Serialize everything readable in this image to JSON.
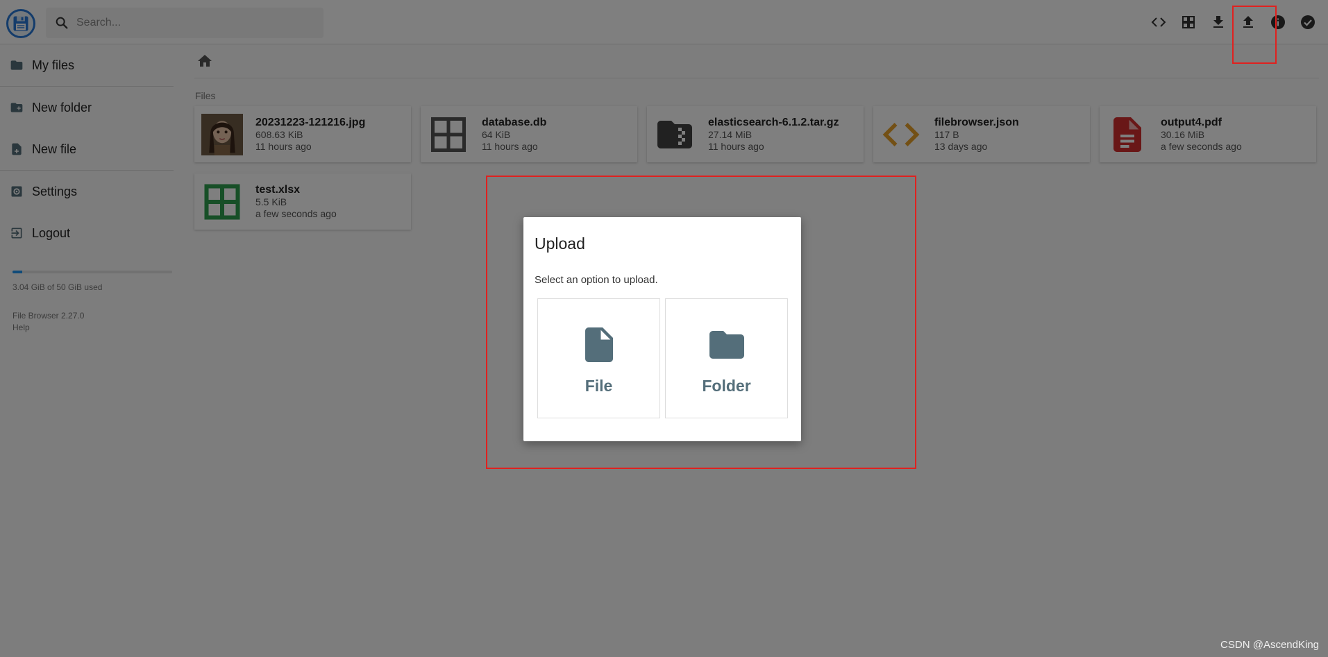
{
  "header": {
    "search_placeholder": "Search...",
    "toolbar": [
      "code-icon",
      "grid-view-icon",
      "download-icon",
      "upload-icon",
      "info-icon",
      "check-circle-icon"
    ]
  },
  "sidebar": {
    "items": [
      {
        "label": "My files",
        "icon": "folder-icon"
      },
      {
        "label": "New folder",
        "icon": "create-new-folder-icon"
      },
      {
        "label": "New file",
        "icon": "note-add-icon"
      },
      {
        "label": "Settings",
        "icon": "settings-icon"
      },
      {
        "label": "Logout",
        "icon": "exit-icon"
      }
    ],
    "usage": {
      "text": "3.04 GiB of 50 GiB used",
      "fraction": 0.061
    },
    "version": "File Browser 2.27.0",
    "help": "Help"
  },
  "main": {
    "section_title": "Files",
    "files": [
      {
        "name": "20231223-121216.jpg",
        "size": "608.63 KiB",
        "time": "11 hours ago",
        "icon": "image-thumbnail"
      },
      {
        "name": "database.db",
        "size": "64 KiB",
        "time": "11 hours ago",
        "icon": "grid-icon",
        "color": "#555555"
      },
      {
        "name": "elasticsearch-6.1.2.tar.gz",
        "size": "27.14 MiB",
        "time": "11 hours ago",
        "icon": "archive-folder-icon",
        "color": "#424242"
      },
      {
        "name": "filebrowser.json",
        "size": "117 B",
        "time": "13 days ago",
        "icon": "code-icon",
        "color": "#e6a12a"
      },
      {
        "name": "output4.pdf",
        "size": "30.16 MiB",
        "time": "a few seconds ago",
        "icon": "pdf-icon",
        "color": "#d32f2f"
      },
      {
        "name": "test.xlsx",
        "size": "5.5 KiB",
        "time": "a few seconds ago",
        "icon": "spreadsheet-icon",
        "color": "#2e9e4e"
      }
    ]
  },
  "dialog": {
    "title": "Upload",
    "text": "Select an option to upload.",
    "file_label": "File",
    "folder_label": "Folder"
  },
  "watermark": "CSDN @AscendKing",
  "colors": {
    "accent": "#2979d6",
    "highlight": "#e0211f",
    "option": "#546e7a"
  }
}
